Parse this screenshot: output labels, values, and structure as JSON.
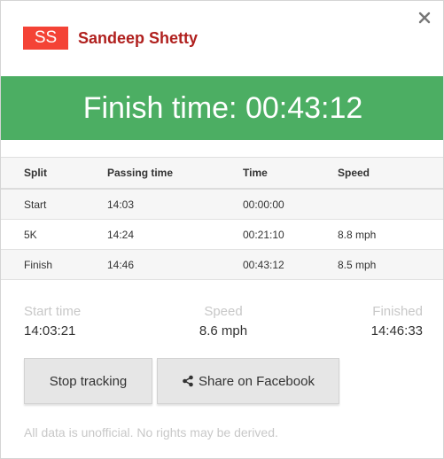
{
  "runner": {
    "initials": "SS",
    "name": "Sandeep Shetty"
  },
  "banner": {
    "text": "Finish time: 00:43:12"
  },
  "table": {
    "headers": [
      "Split",
      "Passing time",
      "Time",
      "Speed"
    ],
    "rows": [
      [
        "Start",
        "14:03",
        "00:00:00",
        ""
      ],
      [
        "5K",
        "14:24",
        "00:21:10",
        "8.8 mph"
      ],
      [
        "Finish",
        "14:46",
        "00:43:12",
        "8.5 mph"
      ]
    ]
  },
  "stats": {
    "start_label": "Start time",
    "start_value": "14:03:21",
    "speed_label": "Speed",
    "speed_value": "8.6 mph",
    "finished_label": "Finished",
    "finished_value": "14:46:33"
  },
  "buttons": {
    "stop": "Stop tracking",
    "share": "Share on Facebook"
  },
  "footer": "All data is unofficial. No rights may be derived.",
  "icons": {
    "close": "close-icon",
    "share": "share-icon"
  },
  "colors": {
    "badge": "#f44336",
    "name": "#b0201e",
    "banner": "#4cae63"
  }
}
